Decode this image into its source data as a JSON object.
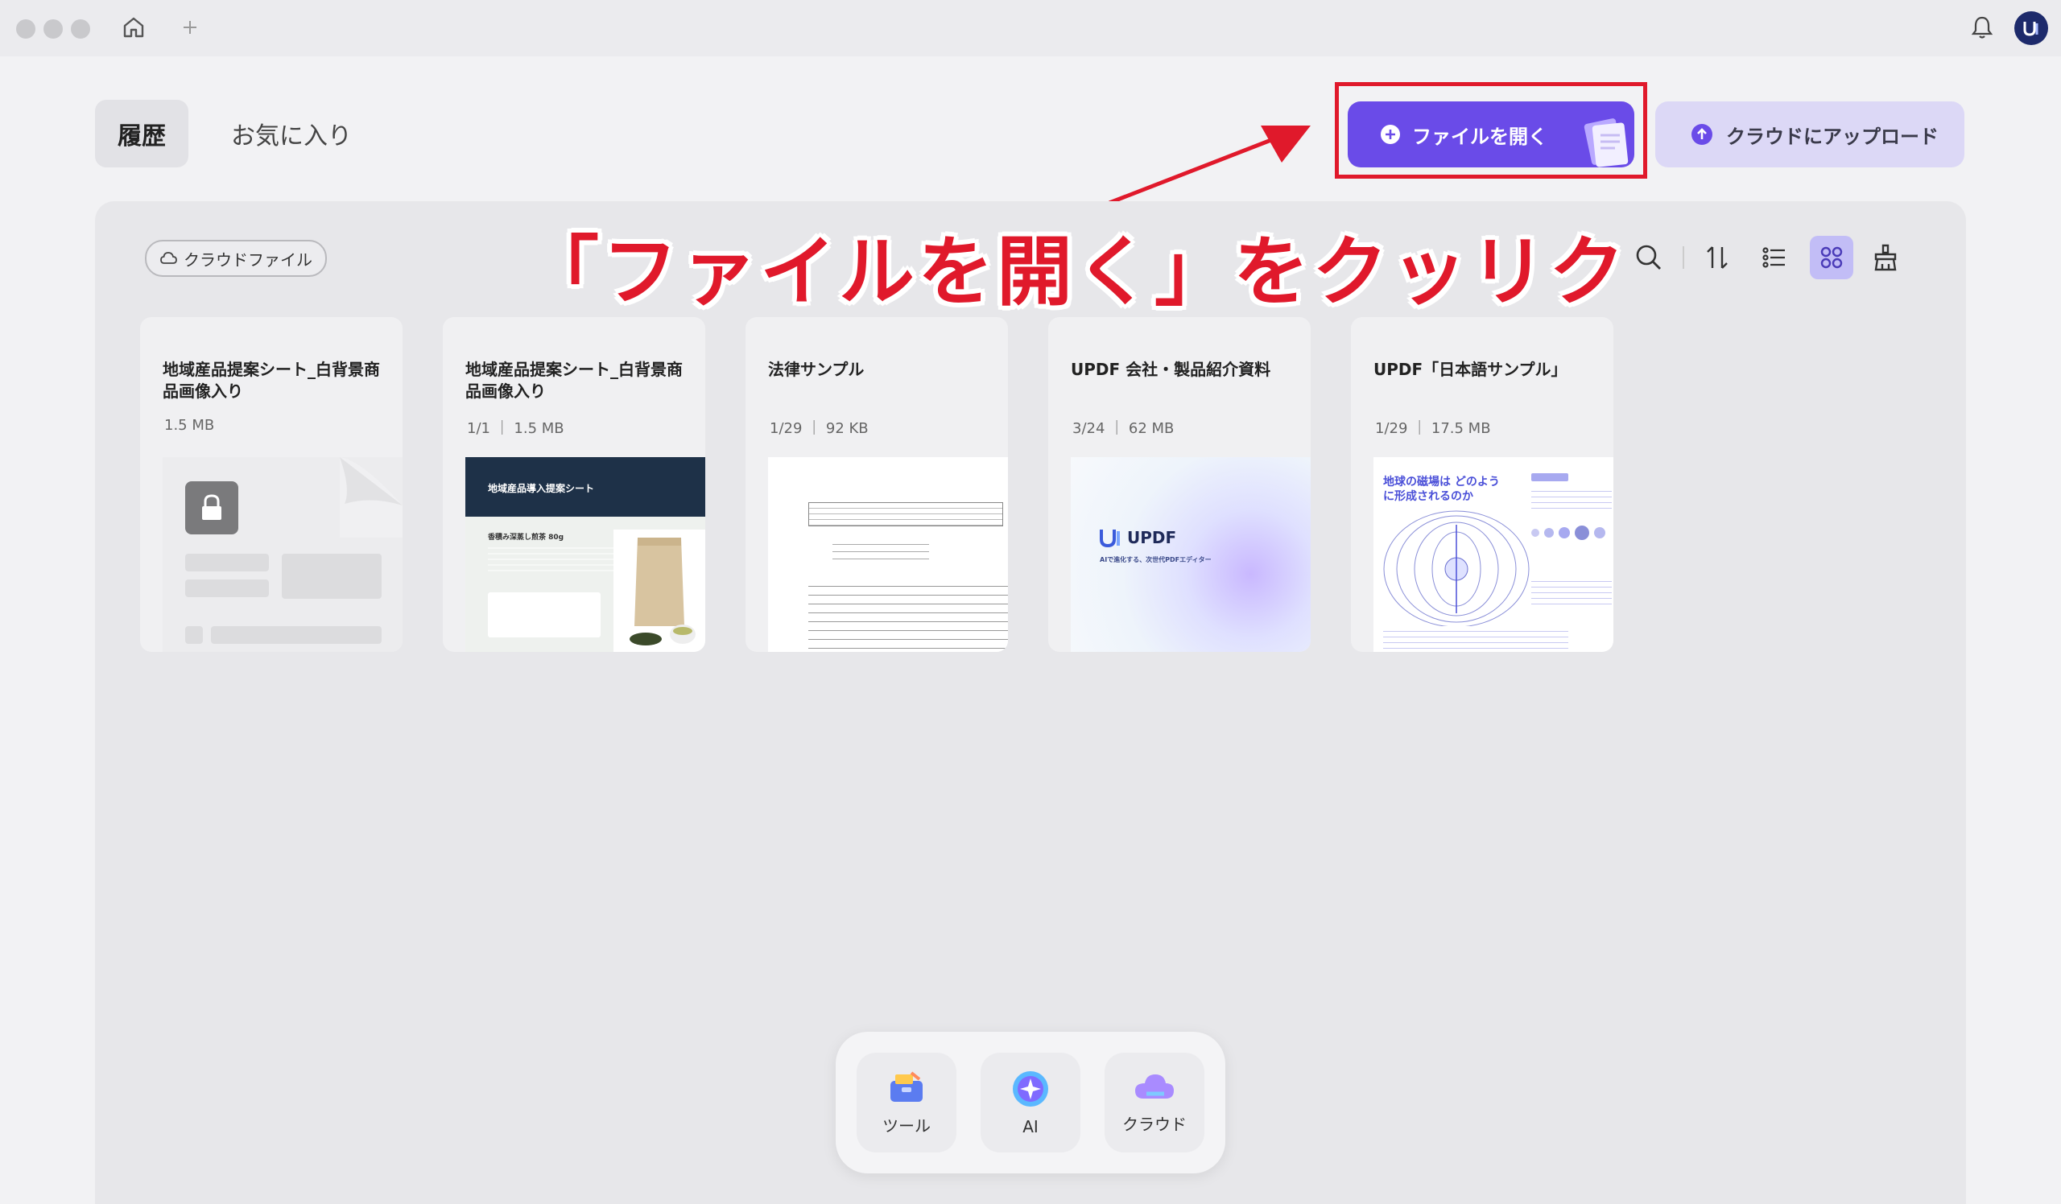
{
  "tabs": {
    "history": "履歴",
    "favorites": "お気に入り"
  },
  "actions": {
    "open_file": "ファイルを開く",
    "upload_cloud": "クラウドにアップロード"
  },
  "chip": {
    "cloud_files": "クラウドファイル"
  },
  "annotation": {
    "text": "「ファイルを開く」をクッリク"
  },
  "files": [
    {
      "title": "地域産品提案シート_白背景商品画像入り",
      "meta": "1.5 MB"
    },
    {
      "title": "地域産品提案シート_白背景商品画像入り",
      "meta": "1/1 ｜ 1.5 MB"
    },
    {
      "title": "法律サンプル",
      "meta": "1/29 ｜ 92 KB"
    },
    {
      "title": "UPDF 会社・製品紹介資料",
      "meta": "3/24 ｜ 62 MB"
    },
    {
      "title": "UPDF「日本語サンプル」",
      "meta": "1/29 ｜ 17.5 MB"
    }
  ],
  "thumbs": {
    "proposal_header": "地域産品導入提案シート",
    "proposal_sub": "香積み深蒸し煎茶 80g",
    "updf_logo": "UPDF",
    "updf_tagline": "AIで進化する、次世代PDFエディター",
    "sample_heading": "地球の磁場は どのように形成されるのか"
  },
  "dock": {
    "tools": "ツール",
    "ai": "AI",
    "cloud": "クラウド"
  },
  "colors": {
    "accent": "#6a4be8",
    "annotation": "#e0192b",
    "upload_bg": "#dcd8f6"
  }
}
